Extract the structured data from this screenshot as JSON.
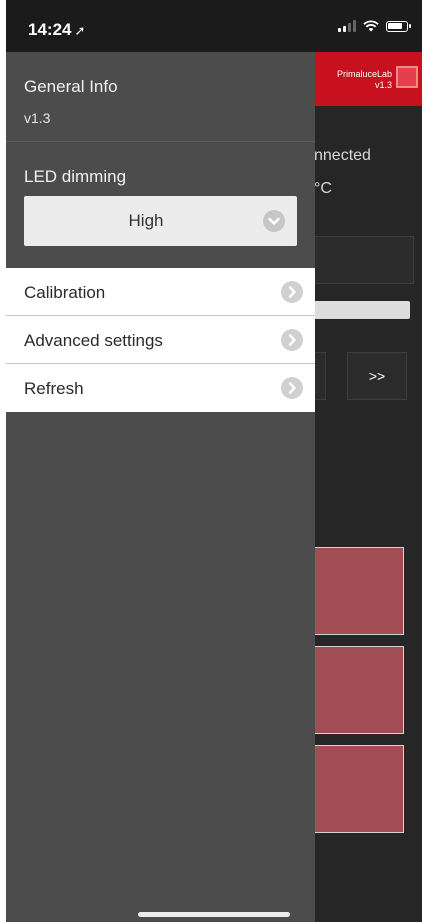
{
  "status_bar": {
    "time": "14:24",
    "location_arrow": "location-arrow-icon",
    "icons": [
      "signal-icon",
      "wifi-icon",
      "battery-icon"
    ]
  },
  "background_app": {
    "brand_name": "PrimaluceLab",
    "brand_version": "v1.3",
    "connection_status_fragment": "nnected",
    "temperature_fragment": "°C",
    "next_button": ">>",
    "accent_color": "#c8111f",
    "tile_color": "#a24c53"
  },
  "drawer": {
    "general_info_title": "General Info",
    "version": "v1.3",
    "led_dimming_label": "LED dimming",
    "led_dimming_value": "High",
    "menu_items": [
      {
        "label": "Calibration",
        "icon": "chevron-right-icon"
      },
      {
        "label": "Advanced settings",
        "icon": "chevron-right-icon"
      },
      {
        "label": "Refresh",
        "icon": "chevron-right-icon"
      }
    ]
  }
}
